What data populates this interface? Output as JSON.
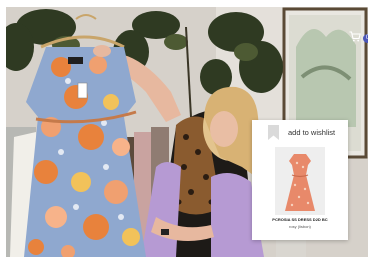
{
  "video": {
    "scene": "woman holding floral wrap dress in front of clothing rack"
  },
  "header": {
    "cart_icon": "shopping-cart-icon",
    "cart_count": "0"
  },
  "wishlist": {
    "icon": "bookmark-icon",
    "label": "add to wishlist",
    "product_name": "PCROSIA SS DRESS D2D BC",
    "product_variant": "rosy (lisbon)"
  },
  "colors": {
    "badge": "#4b56b8",
    "dress_blue": "#8fa8cf",
    "dress_orange": "#e8823c",
    "product_dress": "#e8896a"
  }
}
